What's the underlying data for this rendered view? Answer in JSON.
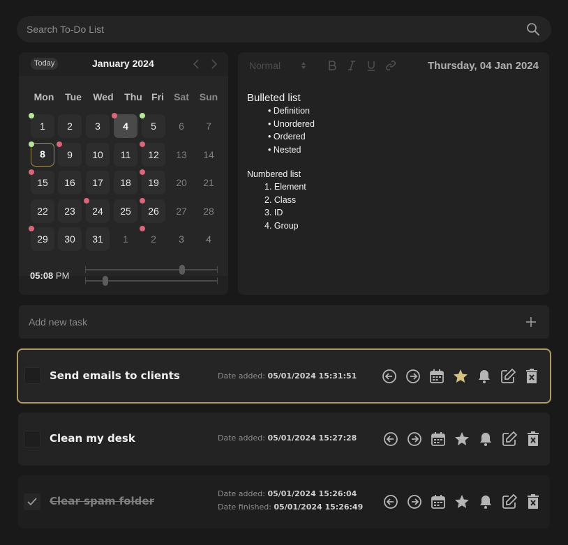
{
  "search": {
    "placeholder": "Search To-Do List"
  },
  "calendar": {
    "today_label": "Today",
    "month_title": "January 2024",
    "weekdays": [
      "Mon",
      "Tue",
      "Wed",
      "Thu",
      "Fri",
      "Sat",
      "Sun"
    ],
    "weeks": [
      [
        "1",
        "2",
        "3",
        "4",
        "5",
        "6",
        "7"
      ],
      [
        "8",
        "9",
        "10",
        "11",
        "12",
        "13",
        "14"
      ],
      [
        "15",
        "16",
        "17",
        "18",
        "19",
        "20",
        "21"
      ],
      [
        "22",
        "23",
        "24",
        "25",
        "26",
        "27",
        "28"
      ],
      [
        "29",
        "30",
        "31",
        "1",
        "2",
        "3",
        "4"
      ]
    ],
    "time": {
      "hours": "05",
      "minutes": "08",
      "separator": ":",
      "period": "PM"
    },
    "colors": {
      "completed_dot": "#b5e79a",
      "pending_dot": "#d9667a",
      "today_border": "#a08e5d"
    }
  },
  "editor": {
    "format_value": "Normal",
    "date": "Thursday, 04 Jan 2024",
    "bulleted_heading": "Bulleted list",
    "bullets": [
      "Definition",
      "Unordered",
      "Ordered",
      "Nested"
    ],
    "numbered_heading": "Numbered list",
    "numbered": [
      "1. Element",
      "2. Class",
      "3. ID",
      "4. Group"
    ]
  },
  "add_task": {
    "placeholder": "Add new task"
  },
  "tasks": [
    {
      "title": "Send emails to clients",
      "added_label": "Date added:",
      "added_value": "05/01/2024 15:31:51",
      "starred": true,
      "completed": false
    },
    {
      "title": "Clean my desk",
      "added_label": "Date added:",
      "added_value": "05/01/2024 15:27:28",
      "starred": false,
      "completed": false
    },
    {
      "title": "Clear spam folder",
      "added_label": "Date added:",
      "added_value": "05/01/2024 15:26:04",
      "finished_label": "Date finished:",
      "finished_value": "05/01/2024 15:26:49",
      "starred": false,
      "completed": true
    }
  ],
  "colors": {
    "accent": "#b09b66",
    "star_active": "#d7c27f",
    "background": "#191919"
  }
}
